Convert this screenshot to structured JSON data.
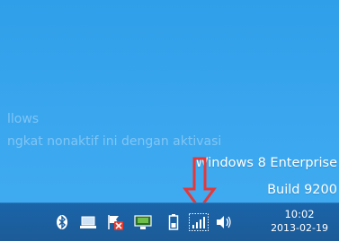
{
  "desktop": {
    "ghost_text_1": "llows",
    "ghost_text_2": "ngkat nonaktif ini dengan aktivasi"
  },
  "watermark": {
    "line1": "Windows 8 Enterprise",
    "line2": "Build 9200"
  },
  "annotation": {
    "arrow_color": "#e53838"
  },
  "taskbar": {
    "tray_icons": [
      {
        "name": "bluetooth-icon"
      },
      {
        "name": "laptop-icon"
      },
      {
        "name": "action-center-flag-icon"
      },
      {
        "name": "display-icon"
      },
      {
        "name": "battery-icon"
      },
      {
        "name": "network-signal-icon"
      },
      {
        "name": "volume-icon"
      }
    ],
    "clock": {
      "time": "10:02",
      "date": "2013-02-19"
    },
    "colors": {
      "bar": "#1c5f9f"
    }
  }
}
